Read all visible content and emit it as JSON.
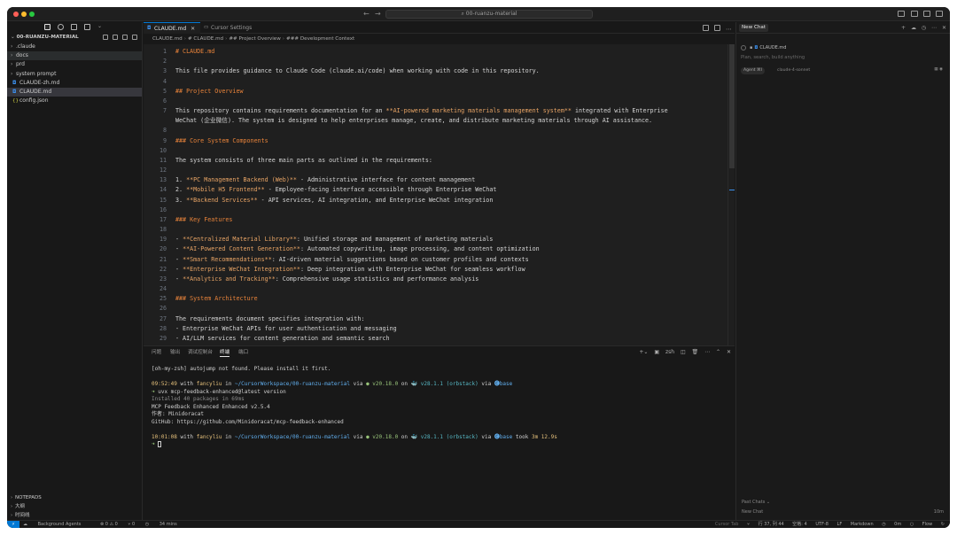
{
  "titlebar": {
    "search": "00-ruanzu-material"
  },
  "sidebar": {
    "header": "00-RUANZU-MATERIAL",
    "items": [
      {
        "label": ".claude",
        "kind": "folder"
      },
      {
        "label": "docs",
        "kind": "folder"
      },
      {
        "label": "prd",
        "kind": "folder"
      },
      {
        "label": "system prompt",
        "kind": "folder"
      },
      {
        "label": "CLAUDE-zh.md",
        "kind": "md"
      },
      {
        "label": "CLAUDE.md",
        "kind": "md"
      },
      {
        "label": "config.json",
        "kind": "json"
      }
    ],
    "sections": [
      "NOTEPADS",
      "大纲",
      "时间线"
    ]
  },
  "tabs": [
    {
      "label": "CLAUDE.md",
      "active": true
    },
    {
      "label": "Cursor Settings",
      "active": false
    }
  ],
  "breadcrumbs": [
    "CLAUDE.md",
    "# CLAUDE.md",
    "## Project Overview",
    "### Development Context"
  ],
  "editor": {
    "lines": [
      {
        "n": "1",
        "text": "# CLAUDE.md",
        "kind": "heading"
      },
      {
        "n": "2",
        "text": "",
        "kind": "plain"
      },
      {
        "n": "3",
        "text": "This file provides guidance to Claude Code (claude.ai/code) when working with code in this repository.",
        "kind": "plain"
      },
      {
        "n": "4",
        "text": "",
        "kind": "plain"
      },
      {
        "n": "5",
        "text": "## Project Overview",
        "kind": "heading"
      },
      {
        "n": "6",
        "text": "",
        "kind": "plain"
      },
      {
        "n": "7",
        "pre": "This repository contains requirements documentation for an ",
        "hl": "**AI-powered marketing materials management system**",
        "post": " integrated with Enterprise",
        "kind": "mixed"
      },
      {
        "n": "",
        "text": "WeChat (企业微信). The system is designed to help enterprises manage, create, and distribute marketing materials through AI assistance.",
        "kind": "plain"
      },
      {
        "n": "8",
        "text": "",
        "kind": "plain"
      },
      {
        "n": "9",
        "text": "### Core System Components",
        "kind": "heading"
      },
      {
        "n": "10",
        "text": "",
        "kind": "plain"
      },
      {
        "n": "11",
        "text": "The system consists of three main parts as outlined in the requirements:",
        "kind": "plain"
      },
      {
        "n": "12",
        "text": "",
        "kind": "plain"
      },
      {
        "n": "13",
        "pre": "1. ",
        "hl": "**PC Management Backend (Web)**",
        "post": " - Administrative interface for content management",
        "kind": "mixed"
      },
      {
        "n": "14",
        "pre": "2. ",
        "hl": "**Mobile H5 Frontend**",
        "post": " - Employee-facing interface accessible through Enterprise WeChat",
        "kind": "mixed"
      },
      {
        "n": "15",
        "pre": "3. ",
        "hl": "**Backend Services**",
        "post": " - API services, AI integration, and Enterprise WeChat integration",
        "kind": "mixed"
      },
      {
        "n": "16",
        "text": "",
        "kind": "plain"
      },
      {
        "n": "17",
        "text": "### Key Features",
        "kind": "heading"
      },
      {
        "n": "18",
        "text": "",
        "kind": "plain"
      },
      {
        "n": "19",
        "pre": "- ",
        "hl": "**Centralized Material Library**",
        "post": ": Unified storage and management of marketing materials",
        "kind": "mixed"
      },
      {
        "n": "20",
        "pre": "- ",
        "hl": "**AI-Powered Content Generation**",
        "post": ": Automated copywriting, image processing, and content optimization",
        "kind": "mixed"
      },
      {
        "n": "21",
        "pre": "- ",
        "hl": "**Smart Recommendations**",
        "post": ": AI-driven material suggestions based on customer profiles and contexts",
        "kind": "mixed"
      },
      {
        "n": "22",
        "pre": "- ",
        "hl": "**Enterprise WeChat Integration**",
        "post": ": Deep integration with Enterprise WeChat for seamless workflow",
        "kind": "mixed"
      },
      {
        "n": "23",
        "pre": "- ",
        "hl": "**Analytics and Tracking**",
        "post": ": Comprehensive usage statistics and performance analysis",
        "kind": "mixed"
      },
      {
        "n": "24",
        "text": "",
        "kind": "plain"
      },
      {
        "n": "25",
        "text": "### System Architecture",
        "kind": "heading"
      },
      {
        "n": "26",
        "text": "",
        "kind": "plain"
      },
      {
        "n": "27",
        "text": "The requirements document specifies integration with:",
        "kind": "plain"
      },
      {
        "n": "28",
        "text": "- Enterprise WeChat APIs for user authentication and messaging",
        "kind": "plain"
      },
      {
        "n": "29",
        "text": "- AI/LLM services for content generation and semantic search",
        "kind": "plain"
      }
    ]
  },
  "panel": {
    "tabs": [
      "问题",
      "输出",
      "调试控制台",
      "终端",
      "端口"
    ],
    "active_tab": "终端",
    "shell": "zsh",
    "lines": [
      {
        "segs": [
          {
            "t": "[oh-my-zsh] autojump not found. Please install it first.",
            "c": ""
          }
        ]
      },
      {
        "segs": [
          {
            "t": "",
            "c": ""
          }
        ]
      },
      {
        "segs": [
          {
            "t": "09:52:49",
            "c": "t-time"
          },
          {
            "t": " with ",
            "c": ""
          },
          {
            "t": "fancyliu",
            "c": "t-user"
          },
          {
            "t": " in ",
            "c": ""
          },
          {
            "t": "~/CursorWorkspace/00-ruanzu-material",
            "c": "t-path"
          },
          {
            "t": " via ",
            "c": ""
          },
          {
            "t": "● v20.18.0",
            "c": "t-node"
          },
          {
            "t": " on ",
            "c": ""
          },
          {
            "t": "🐳 v28.1.1 (orbstack)",
            "c": "t-docker"
          },
          {
            "t": " via ",
            "c": ""
          },
          {
            "t": "🅒base",
            "c": "t-conda"
          }
        ]
      },
      {
        "segs": [
          {
            "t": "➜ ",
            "c": "t-arrow"
          },
          {
            "t": "uvx mcp-feedback-enhanced@latest version",
            "c": ""
          }
        ]
      },
      {
        "segs": [
          {
            "t": "Installed 40 packages in 69ms",
            "c": "t-dim"
          }
        ]
      },
      {
        "segs": [
          {
            "t": "MCP Feedback Enhanced Enhanced v2.5.4",
            "c": ""
          }
        ]
      },
      {
        "segs": [
          {
            "t": "作者: Minidoracat",
            "c": ""
          }
        ]
      },
      {
        "segs": [
          {
            "t": "GitHub: https://github.com/Minidoracat/mcp-feedback-enhanced",
            "c": ""
          }
        ]
      },
      {
        "segs": [
          {
            "t": "",
            "c": ""
          }
        ]
      },
      {
        "segs": [
          {
            "t": "10:01:08",
            "c": "t-time"
          },
          {
            "t": " with ",
            "c": ""
          },
          {
            "t": "fancyliu",
            "c": "t-user"
          },
          {
            "t": " in ",
            "c": ""
          },
          {
            "t": "~/CursorWorkspace/00-ruanzu-material",
            "c": "t-path"
          },
          {
            "t": " via ",
            "c": ""
          },
          {
            "t": "● v20.18.0",
            "c": "t-node"
          },
          {
            "t": " on ",
            "c": ""
          },
          {
            "t": "🐳 v28.1.1 (orbstack)",
            "c": "t-docker"
          },
          {
            "t": " via ",
            "c": ""
          },
          {
            "t": "🅒base",
            "c": "t-conda"
          },
          {
            "t": " took ",
            "c": ""
          },
          {
            "t": "3m 12.9s",
            "c": "t-dur"
          }
        ]
      },
      {
        "segs": [
          {
            "t": "➜ ",
            "c": "t-arrow"
          }
        ]
      }
    ]
  },
  "chat": {
    "tab": "New Chat",
    "context_file": "CLAUDE.md",
    "placeholder": "Plan, search, build anything",
    "mode": "Agent",
    "mode_shortcut": "⌘I",
    "model": "claude-4-sonnet",
    "past_chats_label": "Past Chats",
    "history": [
      {
        "title": "New Chat",
        "when": "10m"
      }
    ]
  },
  "status": {
    "remote": "⚡",
    "agents": "Background Agents",
    "problems": "⊗ 0  ⚠ 0",
    "ports": "⑂ 0",
    "time": "34 mins",
    "cursor_tab": "Cursor Tab",
    "position": "行 37, 列 44",
    "spaces": "空格: 4",
    "encoding": "UTF-8",
    "eol": "LF",
    "language": "Markdown",
    "timer": "0m",
    "flow": "Flow"
  },
  "colors": {
    "accent": "#0078d4",
    "heading": "#e8833a",
    "bold": "#e8a465",
    "traffic": [
      "#ff5f57",
      "#febc2e",
      "#28c840"
    ]
  }
}
